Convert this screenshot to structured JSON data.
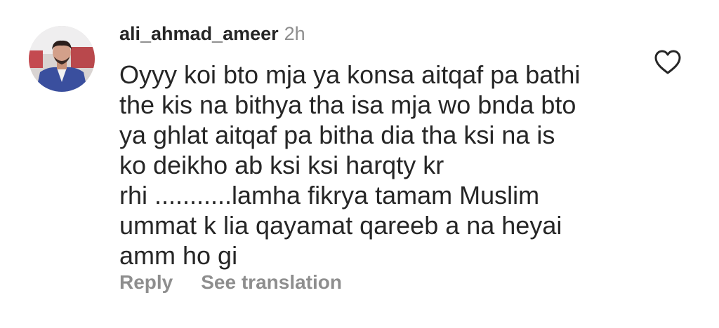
{
  "comment": {
    "username": "ali_ahmad_ameer",
    "time": "2h",
    "lines": [
      "Oyyy koi bto mja ya konsa aitqaf pa bathi",
      "the kis na bithya tha isa mja wo bnda bto",
      "ya ghlat aitqaf pa bitha dia tha ksi na is",
      "ko deikho ab ksi ksi harqty kr",
      "rhi ...........lamha fikrya tamam Muslim",
      "ummat k lia qayamat qareeb a na heyai",
      "amm ho gi"
    ],
    "reply_label": "Reply",
    "translation_label": "See translation",
    "like_icon": "heart-outline-icon",
    "avatar": "profile-photo"
  },
  "colors": {
    "text": "#262626",
    "secondary": "#8e8e8e",
    "background": "#ffffff"
  }
}
